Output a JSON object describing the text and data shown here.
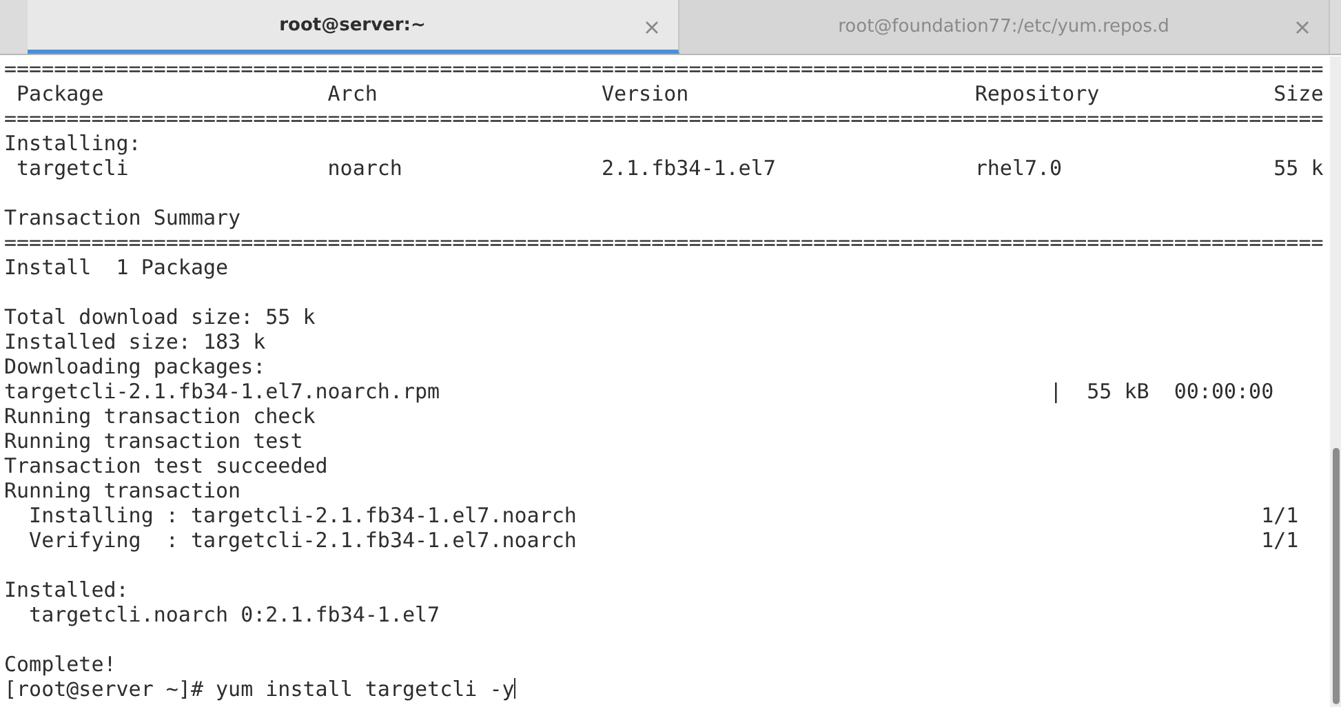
{
  "tabs": [
    {
      "label": "root@server:~",
      "selected": true
    },
    {
      "label": "root@foundation77:/etc/yum.repos.d",
      "selected": false
    }
  ],
  "terminal": {
    "lines": [
      {
        "kind": "rule",
        "text": "=========================================================================================================="
      },
      {
        "kind": "columns",
        "cells": [
          "Package",
          "Arch",
          "Version",
          "Repository",
          "Size"
        ]
      },
      {
        "kind": "rule",
        "text": "=========================================================================================================="
      },
      {
        "kind": "text",
        "text": "Installing:"
      },
      {
        "kind": "columns",
        "cells": [
          "targetcli",
          "noarch",
          "2.1.fb34-1.el7",
          "rhel7.0",
          "55 k"
        ]
      },
      {
        "kind": "blank"
      },
      {
        "kind": "text",
        "text": "Transaction Summary"
      },
      {
        "kind": "rule",
        "text": "=========================================================================================================="
      },
      {
        "kind": "text",
        "text": "Install  1 Package"
      },
      {
        "kind": "blank"
      },
      {
        "kind": "text",
        "text": "Total download size: 55 k"
      },
      {
        "kind": "text",
        "text": "Installed size: 183 k"
      },
      {
        "kind": "text",
        "text": "Downloading packages:"
      },
      {
        "kind": "progress",
        "file": "targetcli-2.1.fb34-1.el7.noarch.rpm",
        "separator": "|",
        "size": "55 kB",
        "elapsed": "00:00:00"
      },
      {
        "kind": "text",
        "text": "Running transaction check"
      },
      {
        "kind": "text",
        "text": "Running transaction test"
      },
      {
        "kind": "text",
        "text": "Transaction test succeeded"
      },
      {
        "kind": "text",
        "text": "Running transaction"
      },
      {
        "kind": "step",
        "text": "  Installing : targetcli-2.1.fb34-1.el7.noarch",
        "counter": "1/1"
      },
      {
        "kind": "step",
        "text": "  Verifying  : targetcli-2.1.fb34-1.el7.noarch",
        "counter": "1/1"
      },
      {
        "kind": "blank"
      },
      {
        "kind": "text",
        "text": "Installed:"
      },
      {
        "kind": "text",
        "text": "  targetcli.noarch 0:2.1.fb34-1.el7"
      },
      {
        "kind": "blank"
      },
      {
        "kind": "text",
        "text": "Complete!"
      },
      {
        "kind": "prompt",
        "prompt": "[root@server ~]#",
        "command": "yum install targetcli -y"
      }
    ]
  }
}
